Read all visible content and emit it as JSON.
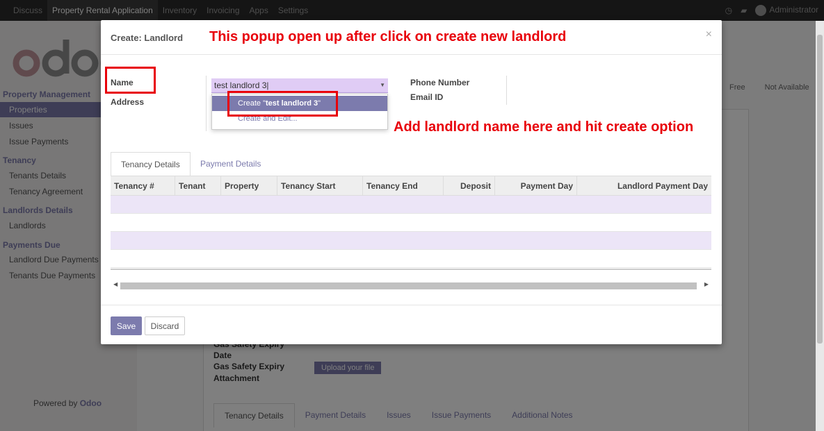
{
  "topbar": {
    "menu": [
      "Discuss",
      "Property Rental Application",
      "Inventory",
      "Invoicing",
      "Apps",
      "Settings"
    ],
    "active_index": 1,
    "user": "Administrator"
  },
  "sidebar": {
    "logo": "odoo",
    "sections": [
      {
        "title": "Property Management",
        "items": [
          "Properties",
          "Issues",
          "Issue Payments"
        ]
      },
      {
        "title": "Tenancy",
        "items": [
          "Tenants Details",
          "Tenancy Agreement"
        ]
      },
      {
        "title": "Landlords Details",
        "items": [
          "Landlords"
        ]
      },
      {
        "title": "Payments Due",
        "items": [
          "Landlord Due Payments",
          "Tenants Due Payments"
        ]
      }
    ],
    "powered_prefix": "Powered by",
    "powered_brand": "Odoo"
  },
  "background": {
    "status": [
      "Free",
      "Not Available"
    ],
    "labels": [
      "Gas Safety Expiry",
      "Date",
      "Gas Safety Expiry",
      "Attachment"
    ],
    "upload_label": "Upload your file",
    "tabs": [
      "Tenancy Details",
      "Payment Details",
      "Issues",
      "Issue Payments",
      "Additional Notes"
    ]
  },
  "modal": {
    "title": "Create: Landlord",
    "close": "×",
    "fields": {
      "name_label": "Name",
      "address_label": "Address",
      "phone_label": "Phone Number",
      "email_label": "Email ID",
      "name_value": "test landlord 3"
    },
    "dropdown": {
      "create_prefix": "Create \"",
      "create_value": "test landlord 3",
      "create_suffix": "\"",
      "create_edit": "Create and Edit..."
    },
    "tabs": [
      "Tenancy Details",
      "Payment Details"
    ],
    "table": {
      "columns": [
        "Tenancy #",
        "Tenant",
        "Property",
        "Tenancy Start",
        "Tenancy End",
        "Deposit",
        "Payment Day",
        "Landlord Payment Day"
      ]
    },
    "footer": {
      "save": "Save",
      "discard": "Discard"
    }
  },
  "annotations": {
    "popup_note": "This popup open up after click on create new landlord",
    "name_note": "Add landlord name here and hit create option",
    "color": "#e8000a"
  }
}
